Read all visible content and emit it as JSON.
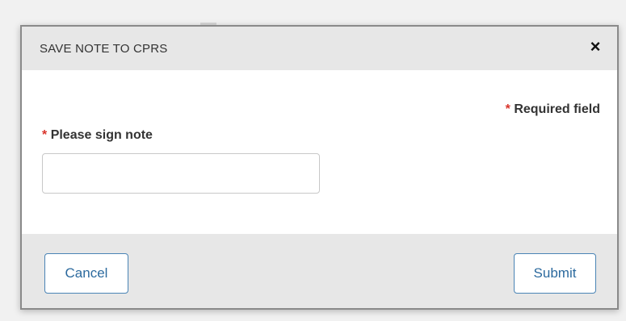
{
  "dialog": {
    "title": "SAVE NOTE TO CPRS",
    "close_glyph": "×",
    "close_icon": "close-icon"
  },
  "form": {
    "required_marker": "*",
    "required_note": "Required field",
    "sign_label": "Please sign note",
    "sign_value": "",
    "sign_placeholder": ""
  },
  "footer": {
    "cancel_label": "Cancel",
    "submit_label": "Submit"
  },
  "colors": {
    "header_bg": "#e7e7e7",
    "required_asterisk": "#d9342b",
    "button_text": "#2c6a9e",
    "button_border": "#4a84b5"
  }
}
